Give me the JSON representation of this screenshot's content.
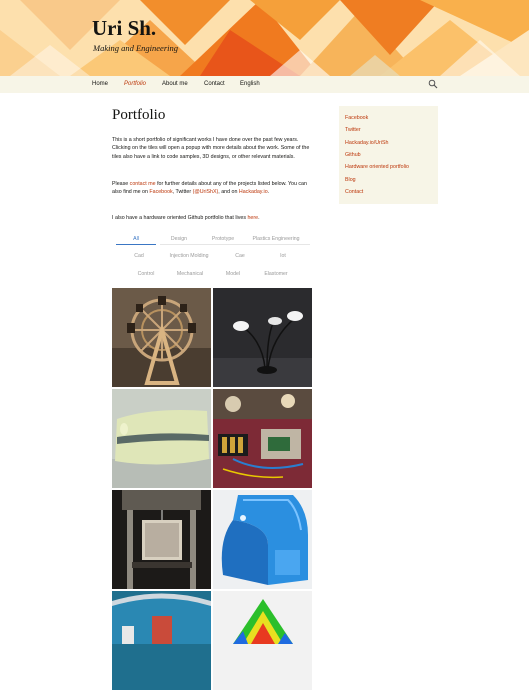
{
  "site": {
    "title": "Uri Sh.",
    "description": "Making and Engineering"
  },
  "nav": {
    "items": [
      {
        "label": "Home"
      },
      {
        "label": "Portfolio"
      },
      {
        "label": "About me"
      },
      {
        "label": "Contact"
      },
      {
        "label": "English"
      }
    ],
    "search_icon": "search-icon"
  },
  "page": {
    "title": "Portfolio",
    "intro": "This is a short portfolio of significant works I have done over the past few years. Clicking on the tiles will open a popup with more details about the work. Some of the tiles also have a link to code samples, 3D designs, or other relevant materials.",
    "contact_pre": "Please ",
    "contact_link": "contact me",
    "contact_mid": " for further details about any of the projects listed below.  You can also find me on  ",
    "facebook_link": "Facebook",
    "contact_mid2": ", Twitter ",
    "twitter_link": "(@UriShX)",
    "contact_mid3": ", and on ",
    "hackaday_link": "Hackaday.io",
    "contact_end": ".",
    "github_pre": "I also have a hardware oriented Github portfolio that lives ",
    "github_link": "here",
    "github_end": "."
  },
  "filters": [
    {
      "label": "All",
      "active": true
    },
    {
      "label": "Design"
    },
    {
      "label": "Prototype"
    },
    {
      "label": "Plastics Engineering"
    },
    {
      "label": "Cad"
    },
    {
      "label": "Injection Molding"
    },
    {
      "label": "Cae"
    },
    {
      "label": "Iot"
    },
    {
      "label": "Control"
    },
    {
      "label": "Mechanical"
    },
    {
      "label": "Model"
    },
    {
      "label": "Elastomer"
    }
  ],
  "sidebar": {
    "links": [
      {
        "label": "Facebook"
      },
      {
        "label": "Twitter"
      },
      {
        "label": "Hackaday.io/UriSh"
      },
      {
        "label": "Github"
      },
      {
        "label": "Hardware oriented portfolio"
      },
      {
        "label": "Blog"
      },
      {
        "label": "Contact"
      }
    ]
  },
  "colors": {
    "link": "#bc360a",
    "accent": "#3a76c4",
    "nav_bg": "#f7f5e7",
    "text": "#141412"
  }
}
